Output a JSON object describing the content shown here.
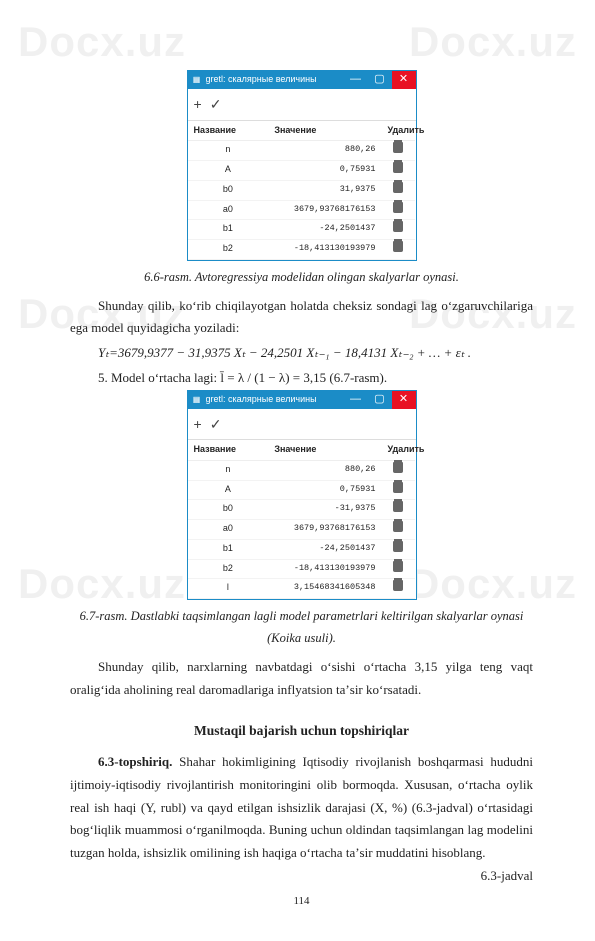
{
  "watermarks": {
    "text": "Docx.uz"
  },
  "window1": {
    "title": "gretl: скалярные величины",
    "plus": "+",
    "check": "✓",
    "headers": {
      "name": "Название",
      "value": "Значение",
      "delete": "Удалить"
    },
    "rows": [
      {
        "name": "n",
        "value": "880,26"
      },
      {
        "name": "A",
        "value": "0,75931"
      },
      {
        "name": "b0",
        "value": "31,9375"
      },
      {
        "name": "a0",
        "value": "3679,93768176153"
      },
      {
        "name": "b1",
        "value": "-24,2501437"
      },
      {
        "name": "b2",
        "value": "-18,413130193979"
      }
    ]
  },
  "caption1": "6.6-rasm. Avtoregressiya modelidan olingan skalyarlar oynasi.",
  "para1": "Shunday qilib, koʻrib chiqilayotgan holatda cheksiz sondagi lag oʻzgaruvchilariga ega model quyidagicha yoziladi:",
  "formula1_left": "Yₜ=3679,9377 − 31,9375 Xₜ − 24,2501 Xₜ₋₁ − 18,4131 Xₜ₋₂ + … + εₜ .",
  "step5": "5. Model oʻrtacha lagi: l̄ = λ / (1 − λ) = 3,15 (6.7-rasm).",
  "window2": {
    "title": "gretl: скалярные величины",
    "rows": [
      {
        "name": "n",
        "value": "880,26"
      },
      {
        "name": "A",
        "value": "0,75931"
      },
      {
        "name": "b0",
        "value": "-31,9375"
      },
      {
        "name": "a0",
        "value": "3679,93768176153"
      },
      {
        "name": "b1",
        "value": "-24,2501437"
      },
      {
        "name": "b2",
        "value": "-18,413130193979"
      },
      {
        "name": "l",
        "value": "3,15468341605348"
      }
    ]
  },
  "caption2": "6.7-rasm. Dastlabki taqsimlangan lagli model parametrlari keltirilgan skalyarlar oynasi (Koika usuli).",
  "para2": "Shunday qilib, narxlarning navbatdagi oʻsishi oʻrtacha 3,15 yilga teng vaqt oraligʻida aholining real daromadlariga inflyatsion taʼsir koʻrsatadi.",
  "heading": "Mustaqil bajarish uchun topshiriqlar",
  "task_label": "6.3-topshiriq.",
  "task_text": " Shahar hokimligining Iqtisodiy rivojlanish boshqarmasi hududni ijtimoiy-iqtisodiy rivojlantirish monitoringini olib bormoqda. Xususan, oʻrtacha oylik real ish haqi (Y, rubl) va qayd etilgan ishsizlik darajasi (X, %) (6.3-jadval) oʻrtasidagi bogʻliqlik muammosi oʻrganilmoqda. Buning uchun oldindan taqsimlangan lag modelini tuzgan holda, ishsizlik omilining ish haqiga oʻrtacha taʼsir muddatini hisoblang.",
  "table_ref": "6.3-jadval",
  "pagenum": "114"
}
